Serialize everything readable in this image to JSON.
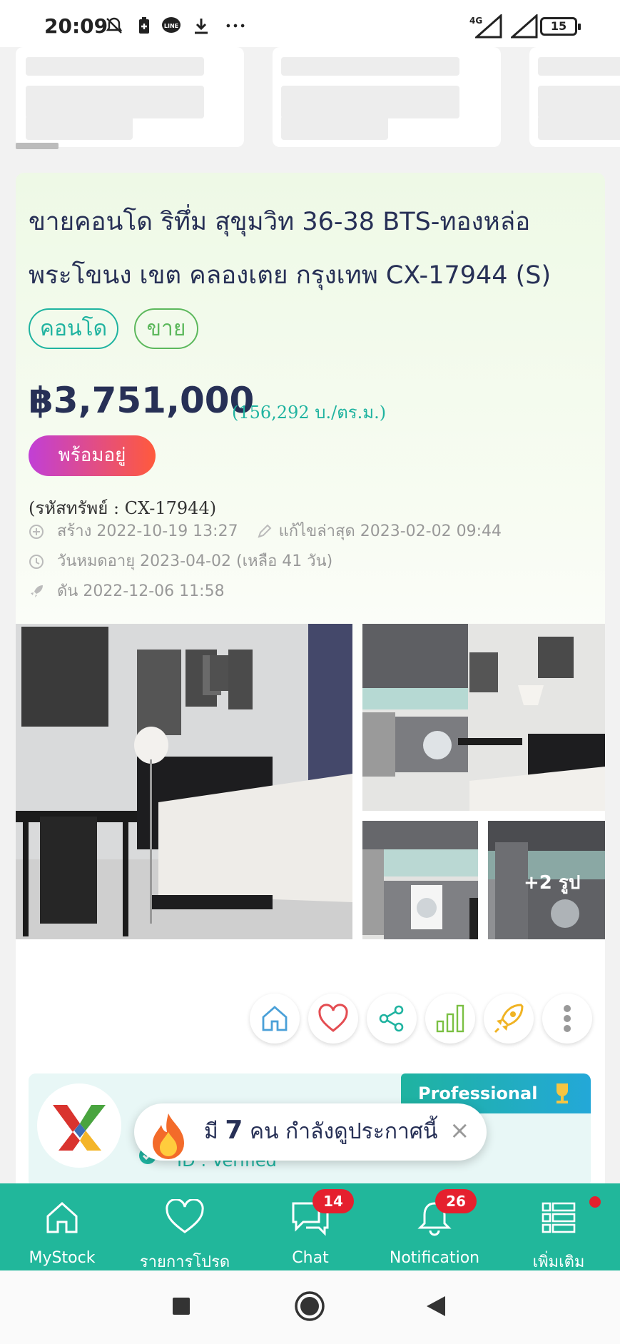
{
  "status_bar": {
    "time": "20:09",
    "network": "4G",
    "battery": "15",
    "icons": [
      "mute-bell-icon",
      "battery-saver-icon",
      "line-icon",
      "download-icon",
      "more-dots-icon",
      "signal-icon",
      "battery-icon"
    ]
  },
  "listing": {
    "title_line1": "ขายคอนโด ริทึ่ม สุขุมวิท 36-38 BTS-ทองหล่อ",
    "title_line2": "พระโขนง เขต คลองเตย กรุงเทพ CX-17944 (S)",
    "tags": [
      "คอนโด",
      "ขาย"
    ],
    "price": "฿3,751,000",
    "price_per_sqm": "(156,292 บ./ตร.ม.)",
    "status_badge": "พร้อมอยู่",
    "property_code": "(รหัสทรัพย์ : CX-17944)",
    "created": "สร้าง 2022-10-19 13:27",
    "edited": "แก้ไขล่าสุด 2023-02-02 09:44",
    "expiry": "วันหมดอายุ 2023-04-02  (เหลือ 41 วัน)",
    "boosted": "ดัน 2022-12-06 11:58",
    "more_photos": "+2 รูป"
  },
  "actions": [
    "home-icon",
    "heart-icon",
    "share-icon",
    "stats-icon",
    "boost-rocket-icon",
    "more-vertical-icon"
  ],
  "agent": {
    "badge": "Professional",
    "verified": "ID : Verified"
  },
  "toast": {
    "prefix": "มี",
    "count": "7",
    "suffix": "คน กำลังดูประกาศนี้",
    "close": "×"
  },
  "bottom_nav": [
    {
      "label": "MyStock"
    },
    {
      "label": "รายการโปรด"
    },
    {
      "label": "Chat",
      "badge": "14"
    },
    {
      "label": "Notification",
      "badge": "26"
    },
    {
      "label": "เพิ่มเติม"
    }
  ],
  "colors": {
    "brand": "#21b79b",
    "title": "#273056",
    "badge": "#e5202e"
  }
}
